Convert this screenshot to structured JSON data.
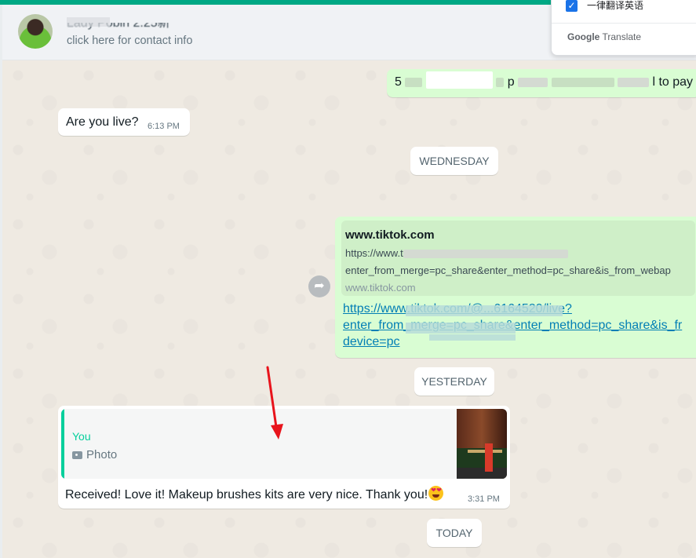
{
  "header": {
    "contact_name": "Lady Pobin 2.25新",
    "contact_subtitle": "click here for contact info"
  },
  "translate_popup": {
    "option_label": "一律翻译英语",
    "brand_google": "Google",
    "brand_translate": "Translate"
  },
  "messages": {
    "outgoing_top": {
      "prefix": "5",
      "mid": "p",
      "suffix": "l to pay"
    },
    "incoming_live": {
      "text": "Are you live?",
      "time": "6:13 PM"
    },
    "date_wednesday": "WEDNESDAY",
    "link_message": {
      "preview_title": "www.tiktok.com",
      "preview_url_line1": "https://www.t",
      "preview_url_line2": "enter_from_merge=pc_share&enter_method=pc_share&is_from_webap",
      "preview_domain": "www.tiktok.com",
      "link_line1": "https://www.tiktok.com/@...6164520/live?",
      "link_line2": "enter_from_merge=pc_share&enter_method=pc_share&is_fr",
      "link_line3": "device=pc"
    },
    "date_yesterday": "YESTERDAY",
    "reply_message": {
      "quote_author": "You",
      "quote_type": "Photo",
      "text": "Received! Love it! Makeup brushes kits are very nice. Thank you!",
      "time": "3:31 PM"
    },
    "date_today": "TODAY"
  },
  "colors": {
    "accent": "#00a884",
    "outgoing_bubble": "#d9fdd3",
    "incoming_bubble": "#ffffff",
    "chat_background": "#efeae2",
    "link": "#027eb5",
    "quote_accent": "#06cf9c",
    "annotation_arrow": "#e8141c"
  }
}
